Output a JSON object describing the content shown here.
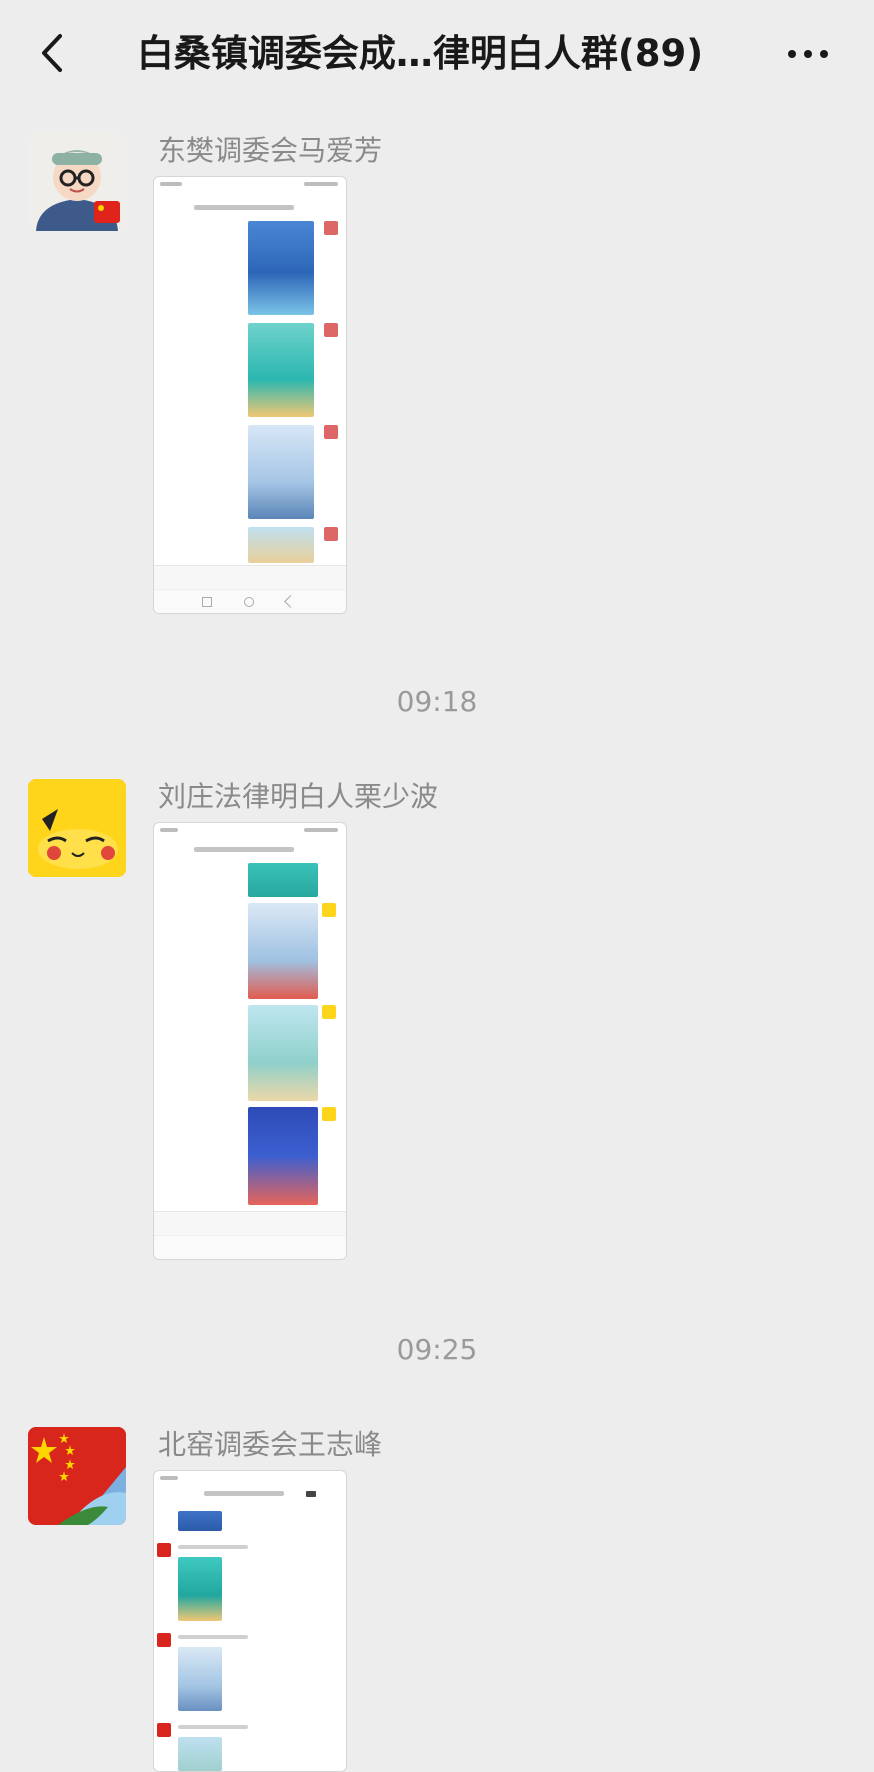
{
  "header": {
    "title": "白桑镇调委会成…律明白人群(89)",
    "back_icon": "chevron-left-icon",
    "more_icon": "ellipsis-icon"
  },
  "messages": [
    {
      "sender": "东樊调委会马爱芳",
      "type": "image",
      "avatar": "cartoon-boy-avatar"
    },
    {
      "sender": "刘庄法律明白人栗少波",
      "type": "image",
      "avatar": "pikachu-avatar"
    },
    {
      "sender": "北窑调委会王志峰",
      "type": "image",
      "avatar": "flag-avatar"
    }
  ],
  "timestamps": [
    "09:18",
    "09:25"
  ],
  "colors": {
    "background": "#ededed",
    "title": "#191919",
    "sender": "#8a8a8a",
    "timestamp": "#9a9a9a"
  }
}
